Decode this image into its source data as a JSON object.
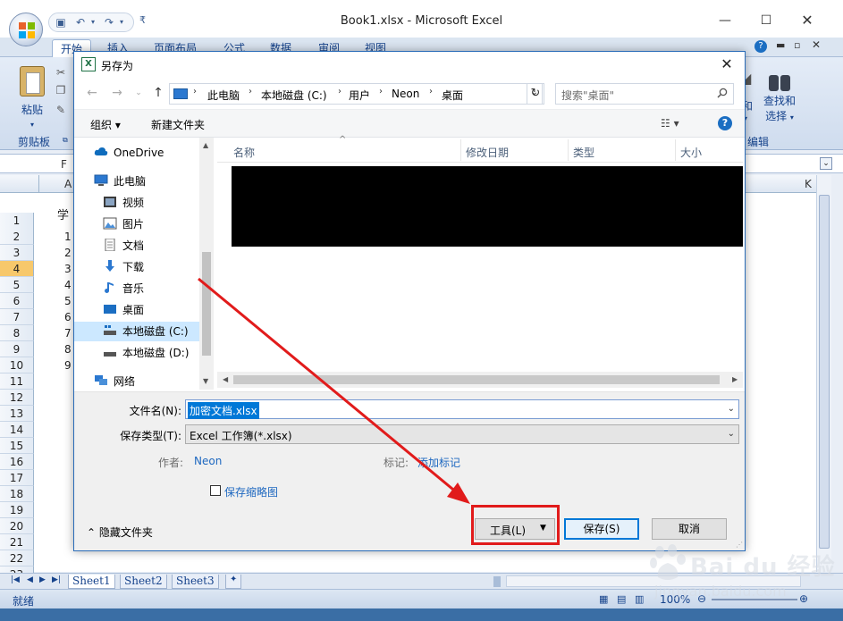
{
  "excel": {
    "window_title": "Book1.xlsx - Microsoft Excel",
    "ribbon_tabs": [
      "开始",
      "插入",
      "页面布局",
      "公式",
      "数据",
      "审阅",
      "视图"
    ],
    "paste_label": "粘贴",
    "clipboard_group": "剪贴板",
    "find_label_1": "查找和",
    "find_label_2": "选择",
    "edit_group": "编辑",
    "formula_text": "F",
    "col_headers": [
      "A",
      "K"
    ],
    "header_cell": "学",
    "row_numbers": [
      "1",
      "2",
      "3",
      "4",
      "5",
      "6",
      "7",
      "8",
      "9",
      "10",
      "11",
      "12",
      "13",
      "14",
      "15",
      "16",
      "17",
      "18",
      "19",
      "20",
      "21",
      "22",
      "23"
    ],
    "col_a_values": [
      "1",
      "2",
      "3",
      "4",
      "5",
      "6",
      "7",
      "8",
      "9"
    ],
    "sheet_tabs": [
      "Sheet1",
      "Sheet2",
      "Sheet3"
    ],
    "status": "就绪",
    "zoom": "100%"
  },
  "dialog": {
    "title": "另存为",
    "breadcrumbs": [
      "此电脑",
      "本地磁盘 (C:)",
      "用户",
      "Neon",
      "桌面"
    ],
    "search_placeholder": "搜索\"桌面\"",
    "organize": "组织 ▾",
    "new_folder": "新建文件夹",
    "help": "?",
    "nav_items": [
      {
        "label": "OneDrive",
        "icon": "cloud-icon"
      },
      {
        "label": "此电脑",
        "icon": "computer-icon"
      },
      {
        "label": "视频",
        "icon": "video-icon"
      },
      {
        "label": "图片",
        "icon": "picture-icon"
      },
      {
        "label": "文档",
        "icon": "document-icon"
      },
      {
        "label": "下载",
        "icon": "download-icon"
      },
      {
        "label": "音乐",
        "icon": "music-icon"
      },
      {
        "label": "桌面",
        "icon": "desktop-icon"
      },
      {
        "label": "本地磁盘 (C:)",
        "icon": "drive-icon"
      },
      {
        "label": "本地磁盘 (D:)",
        "icon": "drive-icon"
      },
      {
        "label": "网络",
        "icon": "network-icon"
      }
    ],
    "columns": [
      "名称",
      "修改日期",
      "类型",
      "大小"
    ],
    "filename_label": "文件名(N):",
    "filename_value": "加密文档.xlsx",
    "filetype_label": "保存类型(T):",
    "filetype_value": "Excel 工作簿(*.xlsx)",
    "author_label": "作者:",
    "author_value": "Neon",
    "tags_label": "标记:",
    "tags_value": "添加标记",
    "thumbnail_label": "保存缩略图",
    "hide_folders": "隐藏文件夹",
    "tools": "工具(L)",
    "save": "保存(S)",
    "cancel": "取消"
  },
  "colors": {
    "highlight": "#e11b1b",
    "accent": "#0078d7",
    "excel_blue": "#15428b"
  }
}
